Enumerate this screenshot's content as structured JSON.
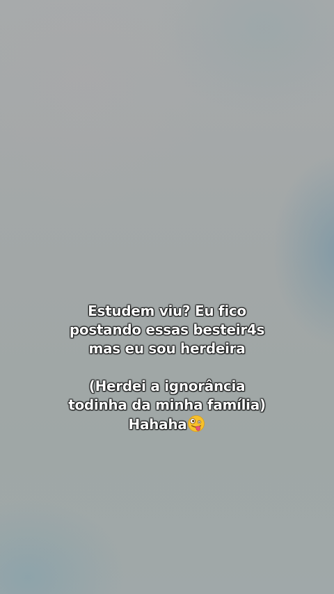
{
  "caption": {
    "line1": "Estudem viu? Eu fico",
    "line2": "postando essas besteir4s",
    "line3": "mas eu sou herdeira",
    "line4": "(Herdei a ignorância",
    "line5": "todinha da minha família)",
    "line6": "Hahaha",
    "emoji": "zany-face-emoji"
  },
  "colors": {
    "background": "#a3a8a8",
    "text": "#ffffff",
    "emoji_face": "#f7c02b",
    "tongue": "#e8507a"
  }
}
